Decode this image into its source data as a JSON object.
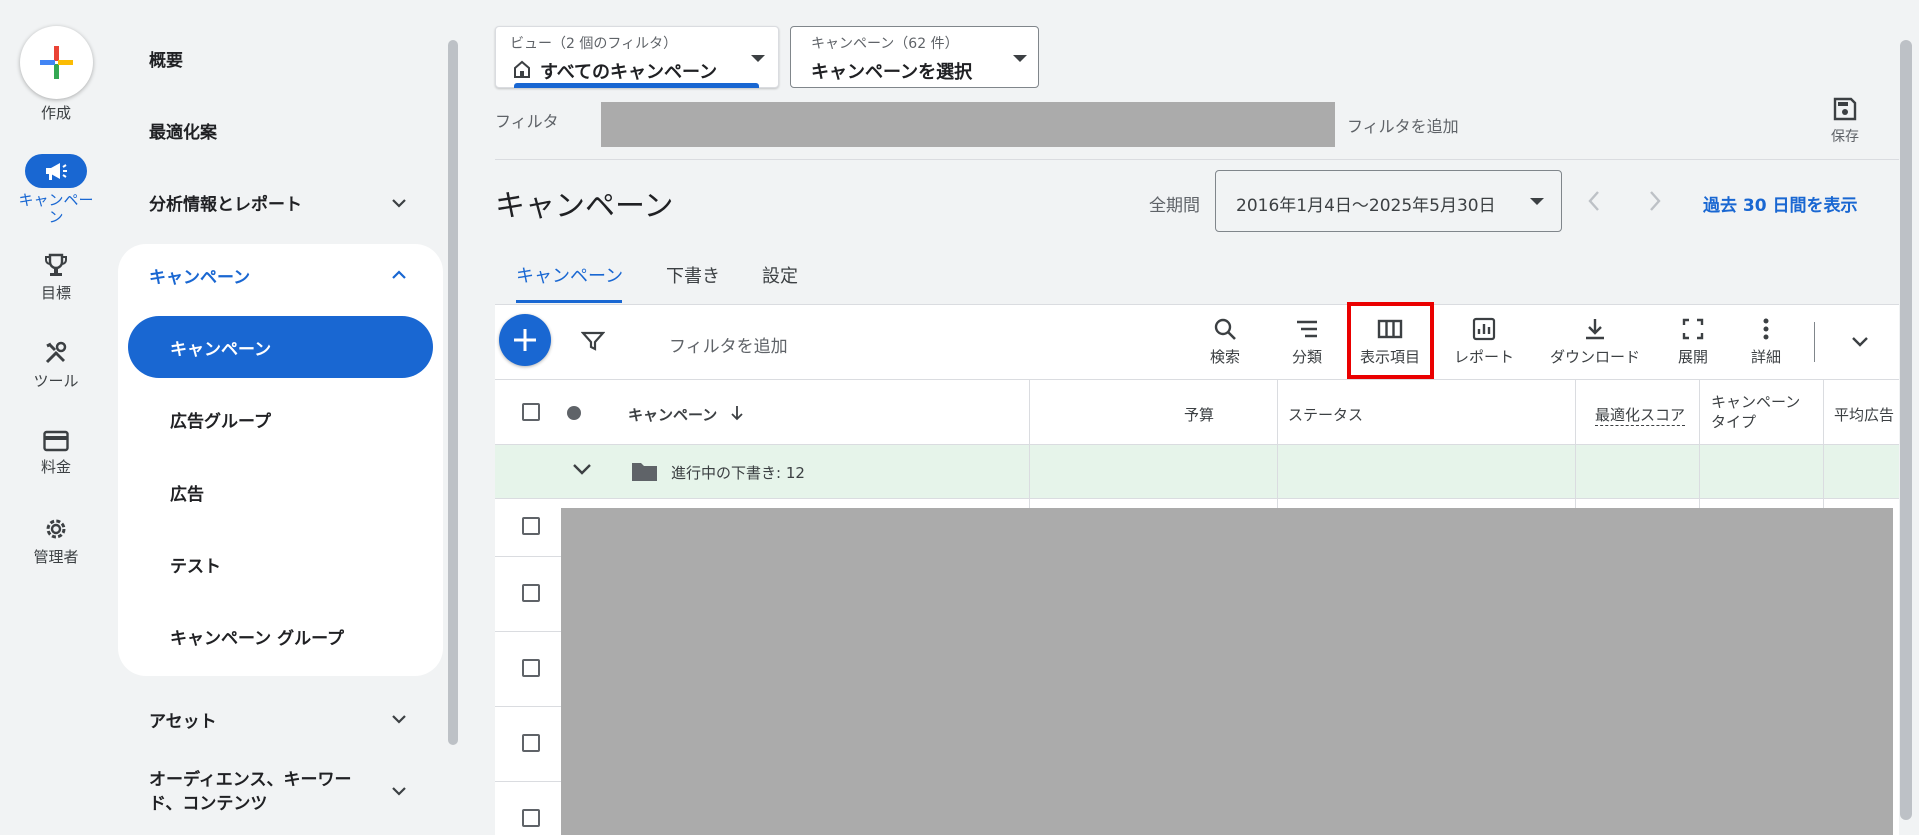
{
  "rail": {
    "create_label": "作成",
    "items": [
      {
        "label": "キャンペー\nン",
        "icon": "megaphone-icon",
        "active": true
      },
      {
        "label": "目標",
        "icon": "trophy-icon"
      },
      {
        "label": "ツール",
        "icon": "tools-icon"
      },
      {
        "label": "料金",
        "icon": "credit-card-icon"
      },
      {
        "label": "管理者",
        "icon": "gear-icon"
      }
    ]
  },
  "nav": {
    "overview": "概要",
    "recommendations": "最適化案",
    "insights": "分析情報とレポート",
    "campaigns_section": "キャンペーン",
    "sub_items": [
      "キャンペーン",
      "広告グループ",
      "広告",
      "テスト",
      "キャンペーン グループ"
    ],
    "assets": "アセット",
    "audiences_line1": "オーディエンス、キーワー",
    "audiences_line2": "ド、コンテンツ"
  },
  "filterbar": {
    "view_caption": "ビュー（2 個のフィルタ）",
    "view_value": "すべてのキャンペーン",
    "campaign_caption": "キャンペーン（62 件）",
    "campaign_value": "キャンペーンを選択",
    "filter_label": "フィルタ",
    "add_filter": "フィルタを追加",
    "save_label": "保存"
  },
  "header": {
    "title": "キャンペーン",
    "period_label": "全期間",
    "date_range": "2016年1月4日～2025年5月30日",
    "last30_link": "過去 30 日間を表示"
  },
  "tabs": [
    "キャンペーン",
    "下書き",
    "設定"
  ],
  "toolbar": {
    "add_filter": "フィルタを追加",
    "tools": [
      {
        "label": "検索",
        "icon": "search-icon"
      },
      {
        "label": "分類",
        "icon": "segment-icon"
      },
      {
        "label": "表示項目",
        "icon": "columns-icon",
        "highlighted": true
      },
      {
        "label": "レポート",
        "icon": "report-icon"
      },
      {
        "label": "ダウンロード",
        "icon": "download-icon"
      },
      {
        "label": "展開",
        "icon": "expand-icon"
      },
      {
        "label": "詳細",
        "icon": "more-vert-icon"
      }
    ]
  },
  "table": {
    "columns": {
      "campaign": "キャンペーン",
      "budget": "予算",
      "status": "ステータス",
      "optimization_score": "最適化スコア",
      "campaign_type_l1": "キャンペーン",
      "campaign_type_l2": "タイプ",
      "avg": "平均広告"
    },
    "draft_row": "進行中の下書き: 12"
  },
  "colors": {
    "accent": "#1967d2",
    "highlight": "#ea0000",
    "draft_row_bg": "#e6f4ea"
  }
}
